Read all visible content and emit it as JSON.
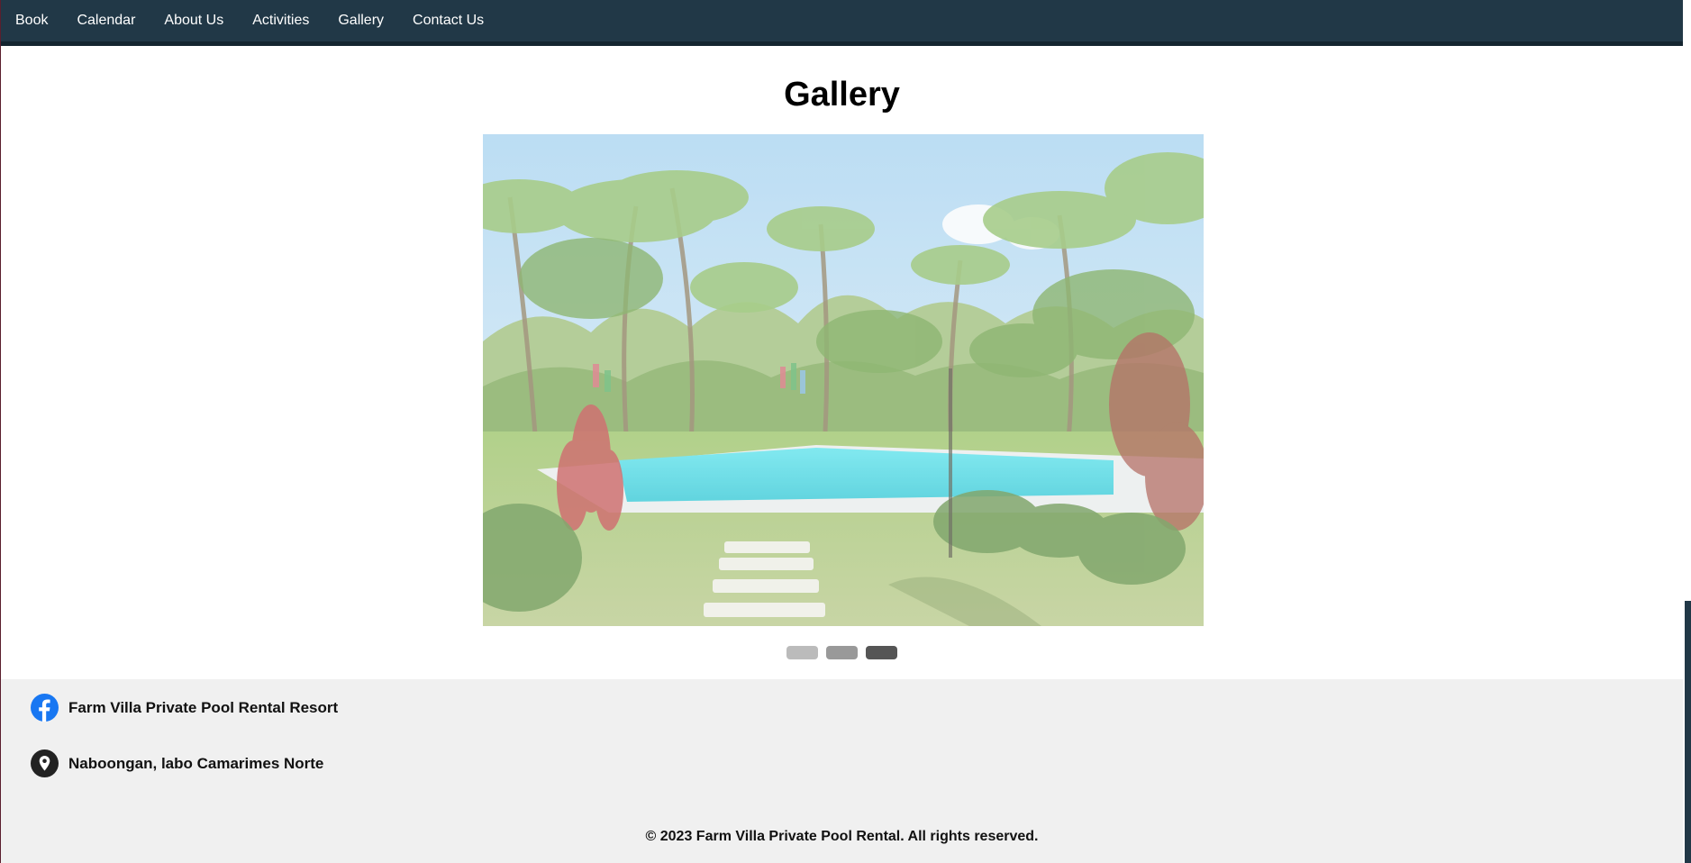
{
  "nav": {
    "items": [
      {
        "label": "Book"
      },
      {
        "label": "Calendar"
      },
      {
        "label": "About Us"
      },
      {
        "label": "Activities"
      },
      {
        "label": "Gallery"
      },
      {
        "label": "Contact Us"
      }
    ]
  },
  "main": {
    "title": "Gallery",
    "slideshow": {
      "image_icon": "resort-pool-photo",
      "dots": [
        {
          "color": "#bbbbbb",
          "active": false
        },
        {
          "color": "#999999",
          "active": false
        },
        {
          "color": "#555555",
          "active": true
        }
      ]
    }
  },
  "footer": {
    "facebook": {
      "label": "Farm Villa Private Pool Rental Resort",
      "icon": "facebook-icon",
      "color": "#1877f2"
    },
    "location": {
      "label": "Naboongan, labo Camarimes Norte",
      "icon": "map-pin-icon",
      "color": "#222222"
    },
    "copyright": "© 2023 Farm Villa Private Pool Rental. All rights reserved."
  },
  "colors": {
    "navbar": "#213847",
    "footer_bg": "#f0f0f0"
  }
}
